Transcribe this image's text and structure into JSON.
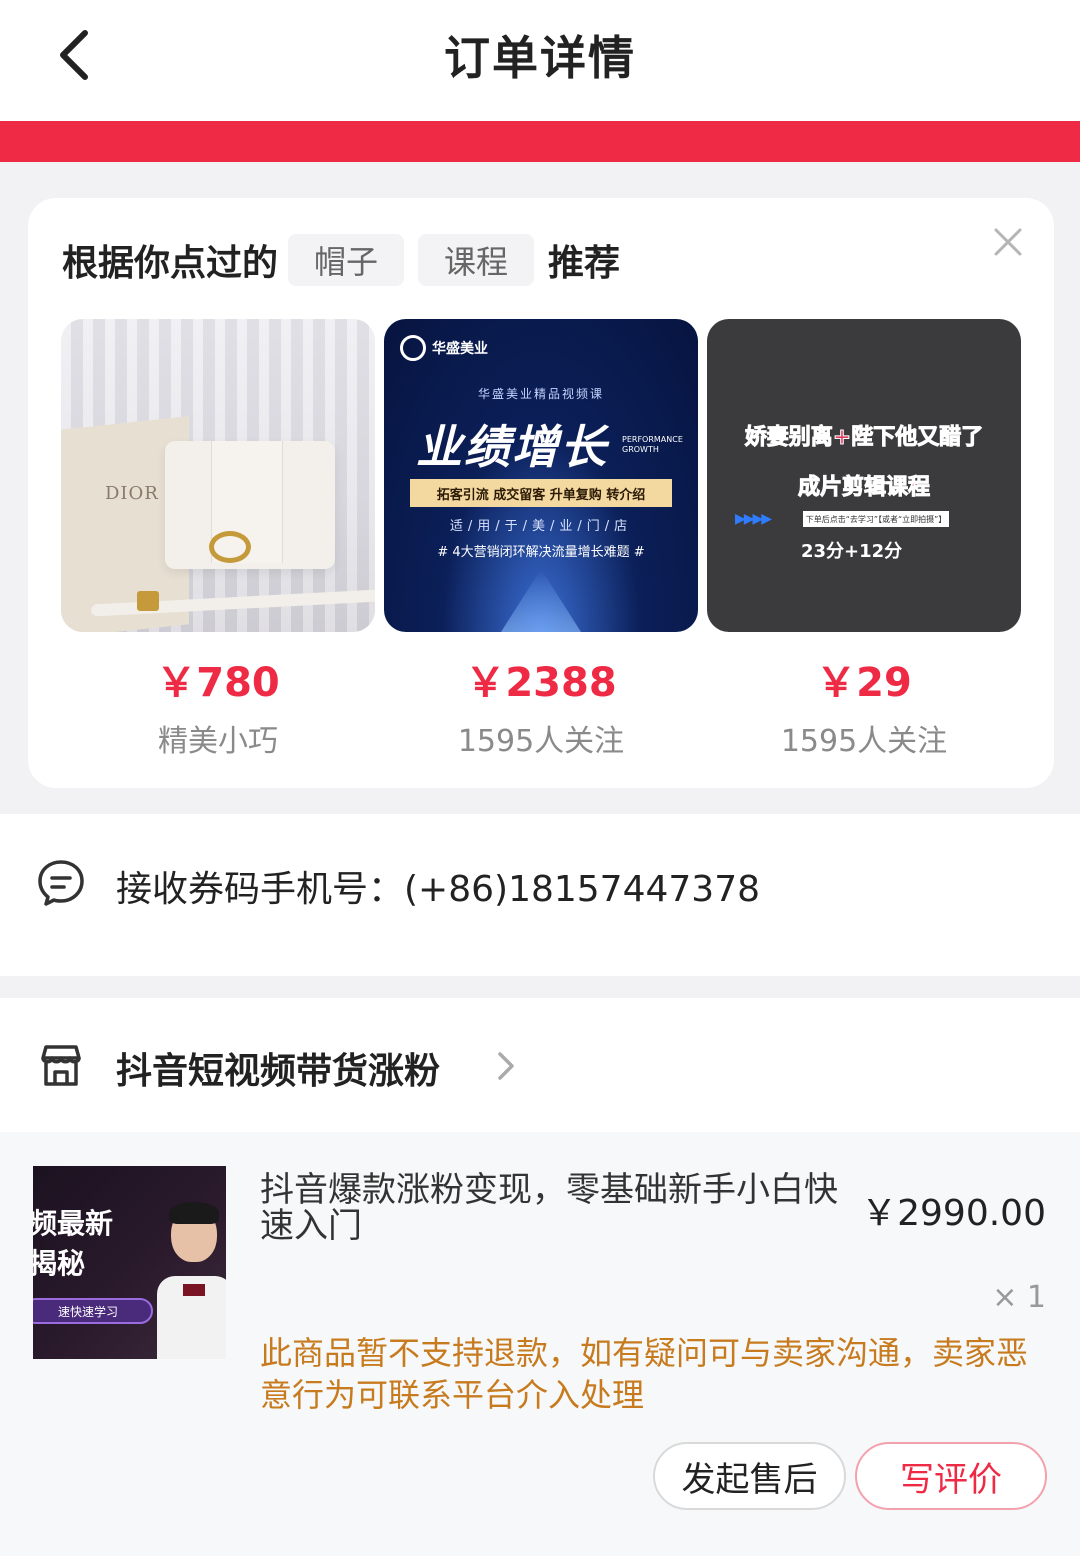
{
  "header": {
    "title": "订单详情"
  },
  "recommend": {
    "prefix": "根据你点过的",
    "tags": [
      "帽子",
      "课程"
    ],
    "suffix": "推荐",
    "items": [
      {
        "price": "￥780",
        "sub": "精美小巧",
        "thumb_text": "DIOR"
      },
      {
        "price": "￥2388",
        "sub": "1595人关注",
        "thumb_brand": "华盛美业",
        "thumb_small": "华盛美业精品视频课",
        "thumb_big": "业绩增长",
        "thumb_perf": "PERFORMANCE GROWTH",
        "thumb_box": "拓客引流 成交留客 升单复购 转介绍",
        "thumb_line": "适/用/于/美/业/门/店",
        "thumb_hash": "# 4大营销闭环解决流量增长难题 #"
      },
      {
        "price": "￥29",
        "sub": "1595人关注",
        "thumb_line1": "娇妻别离+陛下他又醋了",
        "thumb_line2": "成片剪辑课程",
        "thumb_tip": "下单后点击“去学习”【或者“立即拍摄”】",
        "thumb_score": "23分+12分"
      }
    ]
  },
  "phone": {
    "label": "接收券码手机号：(+86)18157447378"
  },
  "order": {
    "shop_name": "抖音短视频带货涨粉",
    "item": {
      "title": "抖音爆款涨粉变现，零基础新手小白快速入门",
      "price": "￥2990.00",
      "qty": "× 1",
      "thumb_t1": "频最新",
      "thumb_t2": "揭秘",
      "thumb_pill": "速快速学习",
      "notice": "此商品暂不支持退款，如有疑问可与卖家沟通，卖家恶意行为可联系平台介入处理"
    },
    "buttons": {
      "after_sale": "发起售后",
      "review": "写评价"
    }
  },
  "colors": {
    "accent": "#ee2a45",
    "notice": "#c77b1e"
  },
  "icons": {
    "back": "chevron-left-icon",
    "close": "close-icon",
    "phone": "chat-doc-icon",
    "shop": "store-icon",
    "shop_chevron": "chevron-right-icon"
  }
}
